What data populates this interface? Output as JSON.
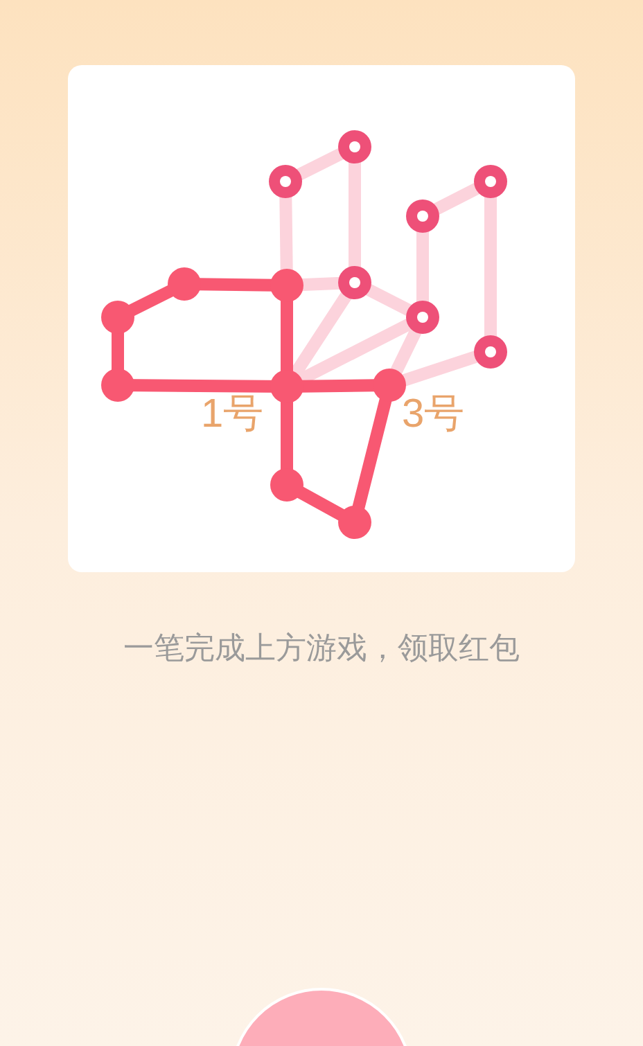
{
  "puzzle": {
    "labels": [
      "1号",
      "3号"
    ]
  },
  "instruction": "一笔完成上方游戏，领取红包"
}
